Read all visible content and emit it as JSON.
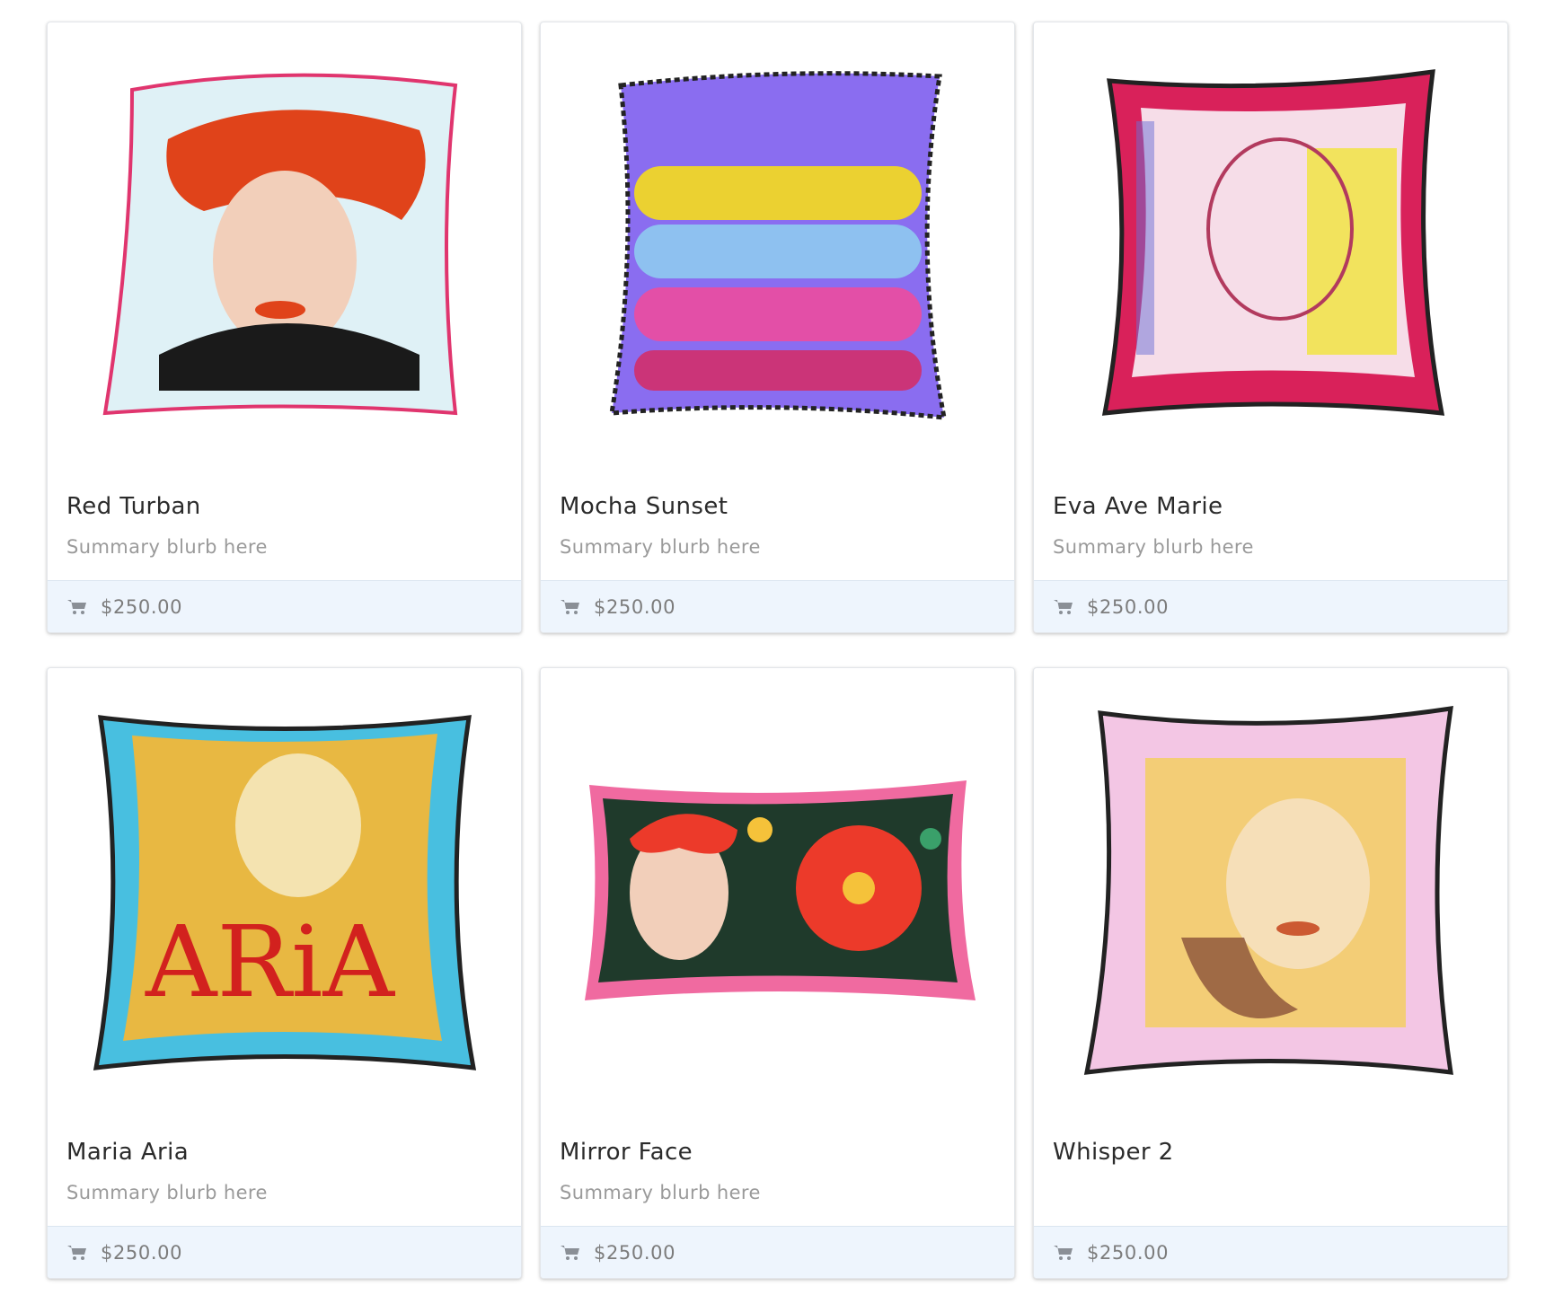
{
  "products": [
    {
      "title": "Red Turban",
      "summary": "Summary blurb here",
      "price": "$250.00",
      "image": {
        "shape": "square",
        "border": "#e0356e",
        "background": "#dff1f6",
        "accents": [
          "#e0431a",
          "#f2cfba",
          "#1a1a1a"
        ]
      }
    },
    {
      "title": "Mocha Sunset",
      "summary": "Summary blurb here",
      "price": "$250.00",
      "image": {
        "shape": "square",
        "border": "#222222",
        "background": "#8a6df0",
        "accents": [
          "#f5dc1c",
          "#8ed6f0",
          "#f24a9a",
          "#d22d6a"
        ]
      }
    },
    {
      "title": "Eva Ave Marie",
      "summary": "Summary blurb here",
      "price": "$250.00",
      "image": {
        "shape": "square",
        "border": "#d9215a",
        "background": "#f6dde8",
        "accents": [
          "#f1e53a",
          "#b23a5e",
          "#6a6fd6"
        ]
      }
    },
    {
      "title": "Maria Aria",
      "summary": "Summary blurb here",
      "price": "$250.00",
      "image": {
        "shape": "square",
        "border": "#48bfe0",
        "background": "#e8b842",
        "accents": [
          "#d2211e",
          "#b86a24",
          "#f4e3b0"
        ]
      }
    },
    {
      "title": "Mirror Face",
      "summary": "Summary blurb here",
      "price": "$250.00",
      "image": {
        "shape": "wide",
        "border": "#f06aa0",
        "background": "#1f3a2b",
        "accents": [
          "#ec3a2a",
          "#f5c23a",
          "#3aa06a"
        ]
      }
    },
    {
      "title": "Whisper 2",
      "summary": "",
      "price": "$250.00",
      "image": {
        "shape": "square",
        "border": "#f2b8dc",
        "background": "#f3c6e4",
        "accents": [
          "#f3cf52",
          "#cc5a32",
          "#7a4030"
        ]
      }
    }
  ],
  "footer_icon": "cart-icon",
  "colors": {
    "footer_bg": "#eef5fd",
    "title_text": "#2b2b2b",
    "summary_text": "#9a9a9a",
    "price_text": "#7c7c7c"
  }
}
